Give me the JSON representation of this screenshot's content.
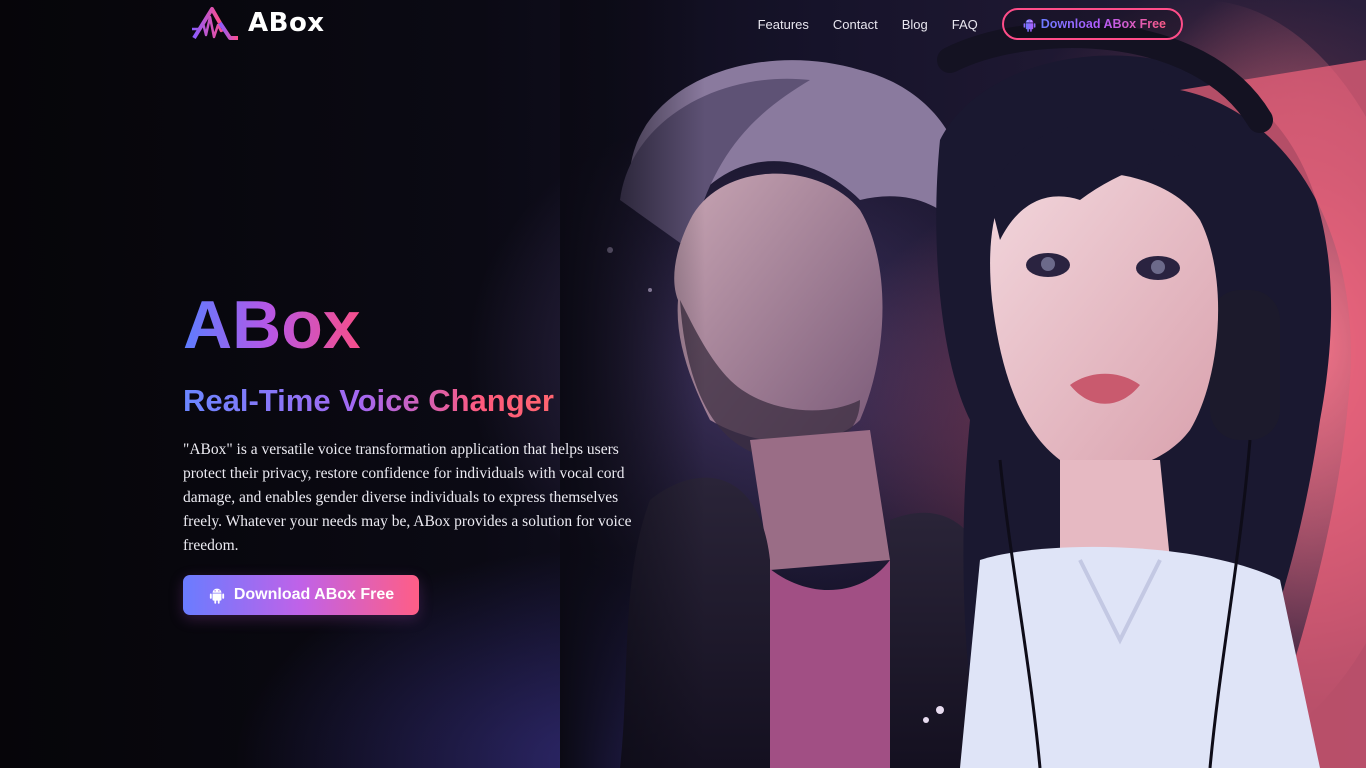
{
  "brand": {
    "name": "ABox",
    "logo_icon": "waveform-a-logo-icon"
  },
  "nav": {
    "links": [
      "Features",
      "Contact",
      "Blog",
      "FAQ"
    ],
    "download_label": "Download ABox Free",
    "download_icon": "android-icon"
  },
  "hero": {
    "title": "ABox",
    "subtitle": "Real-Time Voice Changer",
    "description": "\"ABox\" is a versatile voice transformation application that helps users protect their privacy, restore confidence for individuals with vocal cord damage, and enables gender diverse individuals to express themselves freely. Whatever your needs may be, ABox provides a solution for voice freedom.",
    "download_label": "Download ABox Free",
    "download_icon": "android-icon",
    "illustration": "illustration-man-and-woman-with-headphones"
  },
  "colors": {
    "gradient_start": "#5c7dff",
    "gradient_mid": "#b657e6",
    "gradient_end": "#ff4d7d",
    "nav_border": "#ff4d89"
  }
}
